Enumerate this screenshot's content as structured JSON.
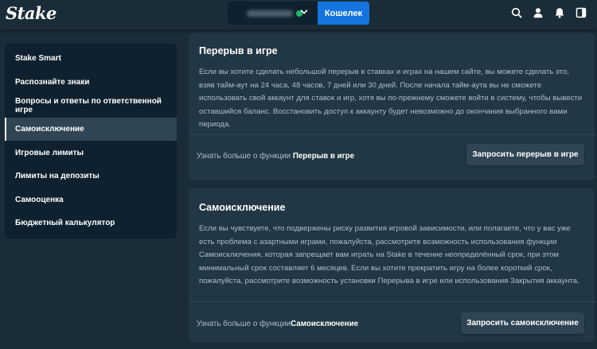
{
  "header": {
    "logo": "Stake",
    "wallet_label": "Кошелек",
    "icons": [
      "search-icon",
      "user-icon",
      "bell-icon",
      "sidebar-toggle-icon"
    ]
  },
  "sidebar": {
    "items": [
      {
        "label": "Stake Smart",
        "active": false
      },
      {
        "label": "Распознайте знаки",
        "active": false
      },
      {
        "label": "Вопросы и ответы по ответственной игре",
        "active": false
      },
      {
        "label": "Самоисключение",
        "active": true
      },
      {
        "label": "Игровые лимиты",
        "active": false
      },
      {
        "label": "Лимиты на депозиты",
        "active": false
      },
      {
        "label": "Самооценка",
        "active": false
      },
      {
        "label": "Бюджетный калькулятор",
        "active": false
      }
    ]
  },
  "cards": [
    {
      "title": "Перерыв в игре",
      "text": "Если вы хотите сделать небольшой перерыв в ставках и играх на нашем сайте, вы можете сделать это, взяв тайм-аут на 24 часа, 48 часов, 7 дней или 30 дней. После начала тайм-аута вы не сможете использовать свой аккаунт для ставок и игр, хотя вы по-прежнему сможете войти в систему, чтобы вывести оставшийся баланс. Восстановить доступ к аккаунту будет невозможно до окончания выбранного вами периода.",
      "footer_prefix": "Узнать больше о функции ",
      "footer_link": "Перерыв в игре",
      "button_label": "Запросить перерыв в игре"
    },
    {
      "title": "Самоисключение",
      "text": "Если вы чувствуете, что подвержены риску развития игровой зависимости, или полагаете, что у вас уже есть проблема с азартными играми, пожалуйста, рассмотрите возможность использования функции Самоисключения, которая запрещает вам играть на Stake в течение неопределённый срок, при этом минимальный срок составляет 6 месяцев. Если вы хотите прекратить игру на более короткий срок, пожалуйста, рассмотрите возможность установки Перерыва в игре или использования Закрытия аккаунта.",
      "footer_prefix": "Узнать больше о функции",
      "footer_link": "Самоисключение",
      "button_label": "Запросить самоисключение"
    }
  ],
  "colors": {
    "background": "#1a2c38",
    "sidebar": "#0f212e",
    "card": "#213743",
    "accent_blue": "#1475e1",
    "muted_text": "#b1bad3"
  }
}
